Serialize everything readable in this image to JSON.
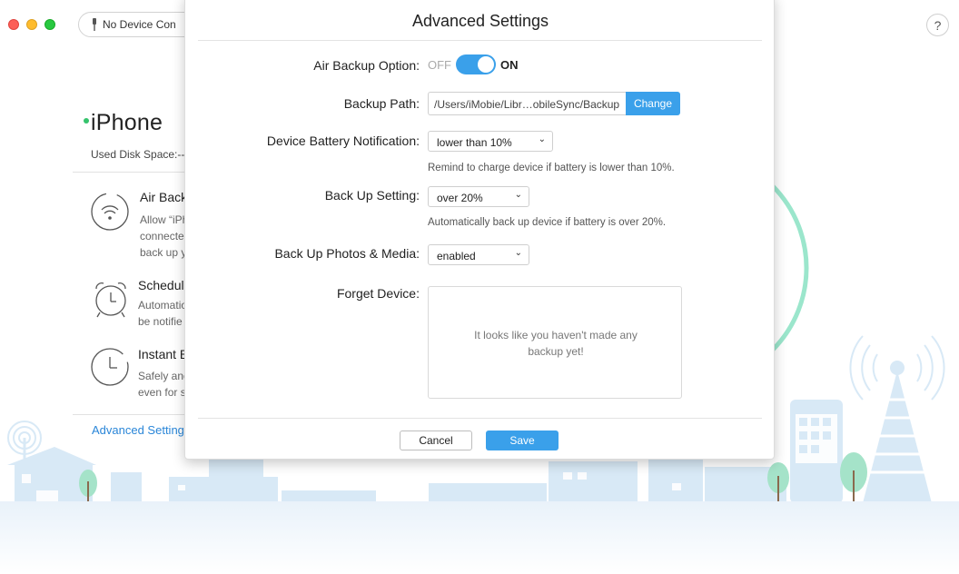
{
  "window": {
    "device_pill_label": "No Device Con",
    "help_label": "?"
  },
  "left": {
    "device_name": "iPhone",
    "disk_space": "Used Disk Space:--",
    "features": [
      {
        "title": "Air Back",
        "desc": [
          "Allow “iPh",
          "connecte",
          "back up y"
        ],
        "icon": "air-backup-icon"
      },
      {
        "title": "Schedul",
        "desc": [
          "Automatio",
          "be notifie"
        ],
        "icon": "alarm-clock-icon"
      },
      {
        "title": "Instant B",
        "desc": [
          "Safely anc",
          "even for s"
        ],
        "icon": "clock-icon"
      }
    ],
    "advanced_link": "Advanced Settings"
  },
  "modal": {
    "title": "Advanced Settings",
    "air_backup": {
      "label": "Air Backup Option:",
      "off_label": "OFF",
      "on_label": "ON",
      "state": "on"
    },
    "backup_path": {
      "label": "Backup Path:",
      "value": "/Users/iMobie/Libr…obileSync/Backup",
      "button": "Change"
    },
    "battery": {
      "label": "Device Battery Notification:",
      "value": "lower than 10%",
      "hint": "Remind to charge device if battery is lower than 10%."
    },
    "backup_setting": {
      "label": "Back Up Setting:",
      "value": "over 20%",
      "hint": "Automatically back up device if battery is over 20%."
    },
    "photos_media": {
      "label": "Back Up Photos & Media:",
      "value": "enabled"
    },
    "forget_device": {
      "label": "Forget Device:",
      "empty_text": "It looks like you haven't made any backup yet!"
    },
    "cancel_label": "Cancel",
    "save_label": "Save"
  },
  "colors": {
    "accent": "#3aa0ea",
    "link": "#2a86d8",
    "illustration": "#d6e8f5",
    "ring": "#8fe0c4"
  }
}
